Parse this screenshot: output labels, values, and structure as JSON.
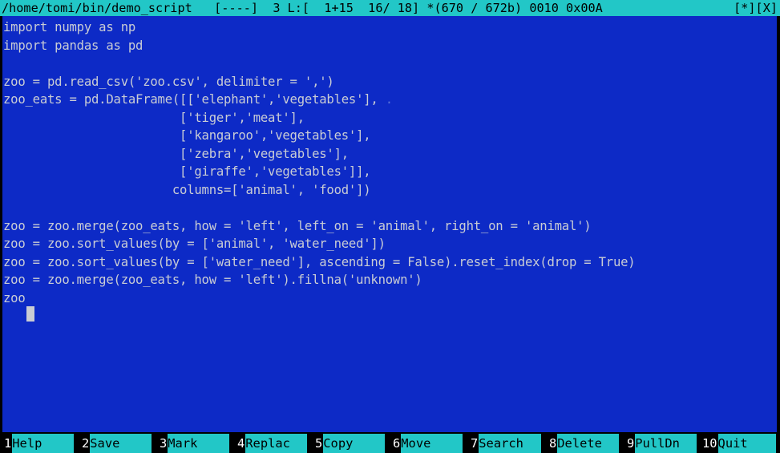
{
  "app": {
    "name": "mcedit",
    "colors": {
      "editor_bg": "#0d2ac6",
      "editor_fg": "#c9ccd4",
      "titlebar_bg": "#22c7c7",
      "titlebar_fg": "#000000",
      "keybar_num_bg": "#000000",
      "keybar_num_fg": "#ffffff",
      "keybar_label_bg": "#22c7c7",
      "keybar_label_fg": "#000000",
      "cursor": "#c9ccd4",
      "border": "#000000"
    }
  },
  "titlebar": {
    "file_path": "/home/tomi/bin/demo_script",
    "modified_indicator": "[----]",
    "column_number": "3",
    "line_info": "L:[  1+15  16/ 18]",
    "byte_info": "*(670 / 672b)",
    "char_code_dec": "0010",
    "char_code_hex": "0x00A",
    "left_text": "/home/tomi/bin/demo_script   [----]  3 L:[  1+15  16/ 18] *(670 / 672b) 0010 0x00A",
    "right_text": "[*][X]",
    "maximize_label": "[*]",
    "close_label": "[X]"
  },
  "editor": {
    "cursor": {
      "line": 16,
      "column": 3,
      "char": "zoo"
    },
    "lines": [
      "import numpy as np",
      "import pandas as pd",
      "",
      "zoo = pd.read_csv('zoo.csv', delimiter = ',')",
      "zoo_eats = pd.DataFrame([['elephant','vegetables'],",
      "                        ['tiger','meat'],",
      "                        ['kangaroo','vegetables'],",
      "                        ['zebra','vegetables'],",
      "                        ['giraffe','vegetables']],",
      "                       columns=['animal', 'food'])",
      "",
      "zoo = zoo.merge(zoo_eats, how = 'left', left_on = 'animal', right_on = 'animal')",
      "zoo = zoo.sort_values(by = ['animal', 'water_need'])",
      "zoo = zoo.sort_values(by = ['water_need'], ascending = False).reset_index(drop = True)",
      "zoo = zoo.merge(zoo_eats, how = 'left').fillna('unknown')",
      "zoo"
    ],
    "continuation_marker": "."
  },
  "keybar": {
    "keys": [
      {
        "num": "1",
        "label": "Help"
      },
      {
        "num": "2",
        "label": "Save"
      },
      {
        "num": "3",
        "label": "Mark"
      },
      {
        "num": "4",
        "label": "Replac"
      },
      {
        "num": "5",
        "label": "Copy"
      },
      {
        "num": "6",
        "label": "Move"
      },
      {
        "num": "7",
        "label": "Search"
      },
      {
        "num": "8",
        "label": "Delete"
      },
      {
        "num": "9",
        "label": "PullDn"
      },
      {
        "num": "10",
        "label": "Quit"
      }
    ]
  }
}
